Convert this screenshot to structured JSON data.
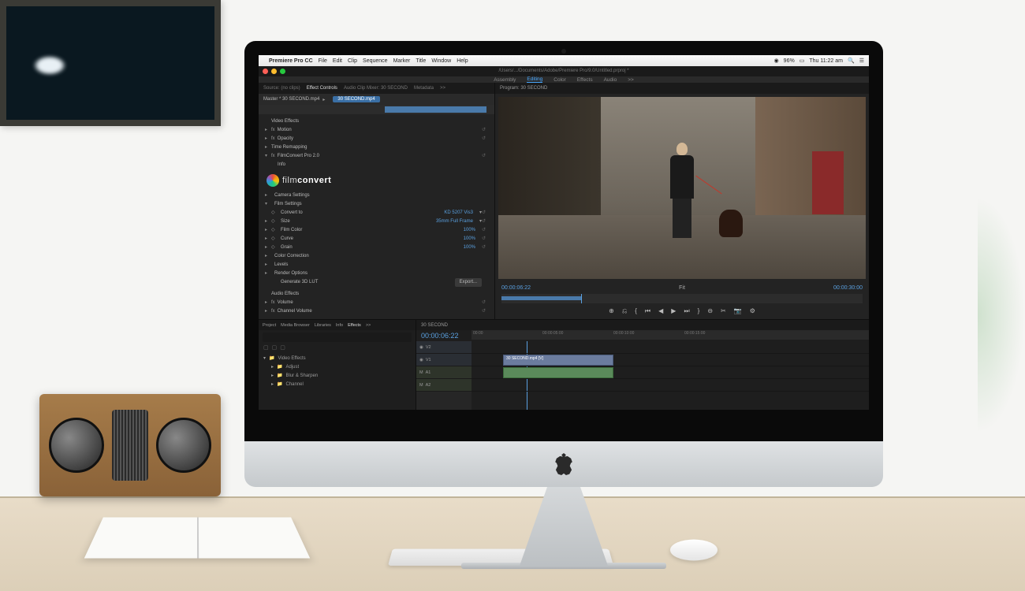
{
  "menubar": {
    "app": "Premiere Pro CC",
    "items": [
      "File",
      "Edit",
      "Clip",
      "Sequence",
      "Marker",
      "Title",
      "Window",
      "Help"
    ],
    "battery": "96%",
    "clock": "Thu 11:22 am"
  },
  "window": {
    "title": "/Users/.../Documents/Adobe/Premiere Pro/9.0/Untitled.prproj *"
  },
  "workspaces": {
    "items": [
      "Assembly",
      "Editing",
      "Color",
      "Effects",
      "Audio",
      ">>"
    ],
    "active": "Editing"
  },
  "source_tabs": {
    "items": [
      "Source: (no clips)",
      "Effect Controls",
      "Audio Clip Mixer: 30 SECOND",
      "Metadata",
      ">>"
    ],
    "active": "Effect Controls"
  },
  "effect_controls": {
    "master_label": "Master * 30 SECOND.mp4",
    "clip_button": "30 SECOND.mp4",
    "sections": {
      "video_effects": "Video Effects",
      "motion": "Motion",
      "opacity": "Opacity",
      "time_remapping": "Time Remapping",
      "filmconvert": "FilmConvert Pro 2.0",
      "info": "Info",
      "camera_settings": "Camera Settings",
      "film_settings": "Film Settings",
      "color_correction": "Color Correction",
      "levels": "Levels",
      "render_options": "Render Options",
      "generate_lut": "Generate 3D LUT",
      "audio_effects": "Audio Effects",
      "volume": "Volume",
      "channel_volume": "Channel Volume"
    },
    "params": {
      "convert_to": {
        "label": "Convert to",
        "value": "KD 5207 Vis3"
      },
      "size": {
        "label": "Size",
        "value": "35mm Full Frame"
      },
      "film_color": {
        "label": "Film Color",
        "value": "100%"
      },
      "curve": {
        "label": "Curve",
        "value": "100%"
      },
      "grain": {
        "label": "Grain",
        "value": "100%"
      }
    },
    "export_btn": "Export..."
  },
  "filmconvert": {
    "brand_a": "film",
    "brand_b": "convert"
  },
  "program": {
    "title": "Program: 30 SECOND",
    "tc_left": "00:00:06:22",
    "fit": "Fit",
    "tc_right": "00:00:30:00"
  },
  "transport": {
    "buttons": [
      "⊕",
      "⎌",
      "{",
      "⏮",
      "◀",
      "▶",
      "⏭",
      "}",
      "⊖",
      "✂",
      "📷",
      "⚙"
    ]
  },
  "effects_browser": {
    "tabs": [
      "Project",
      "Media Browser",
      "Libraries",
      "Info",
      "Effects",
      ">>"
    ],
    "active": "Effects",
    "folders": [
      "Video Effects",
      "Adjust",
      "Blur & Sharpen",
      "Channel"
    ]
  },
  "timeline": {
    "sequence": "30 SECOND",
    "tc": "00:00:06:22",
    "ruler": [
      "00:00",
      "00:00:05:00",
      "00:00:10:00",
      "00:00:15:00"
    ],
    "tracks": {
      "v2": "V2",
      "v1": "V1",
      "a1": "A1",
      "a2": "A2"
    },
    "clip_name": "30 SECOND.mp4 [V]"
  }
}
